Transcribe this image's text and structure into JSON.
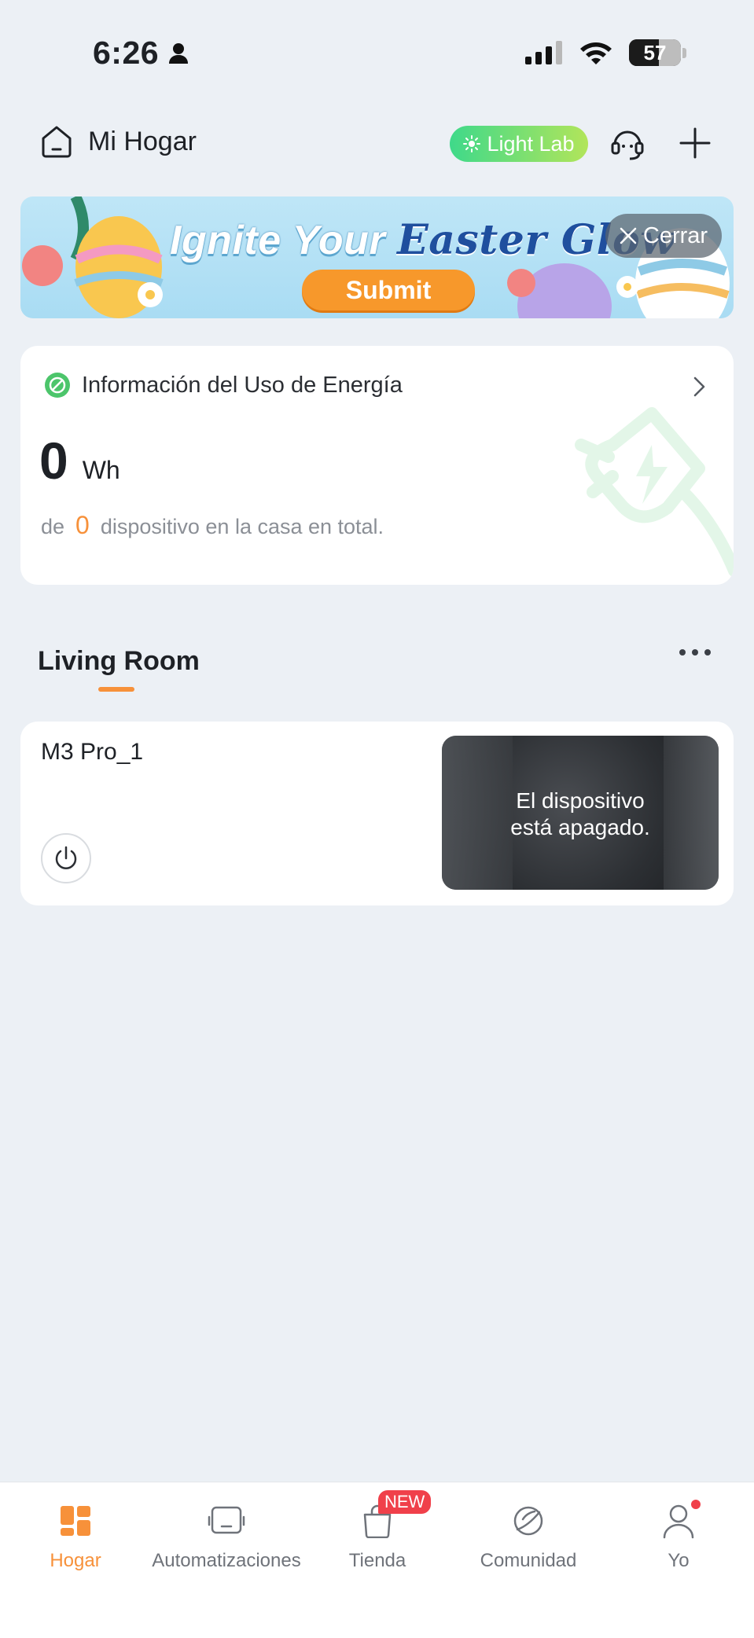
{
  "status_bar": {
    "time": "6:26",
    "battery": "57"
  },
  "header": {
    "home_title": "Mi Hogar",
    "light_lab": "Light Lab"
  },
  "banner": {
    "title_part1": "Ignite Your ",
    "title_part2": "Easter Glow",
    "submit": "Submit",
    "close": "Cerrar"
  },
  "energy": {
    "title": "Información del Uso de Energía",
    "value": "0",
    "unit": "Wh",
    "prefix": "de",
    "count": "0",
    "suffix": "dispositivo en la casa en total."
  },
  "room": {
    "title": "Living Room"
  },
  "device": {
    "name": "M3 Pro_1",
    "status_line1": "El dispositivo",
    "status_line2": "está apagado."
  },
  "bottom_nav": {
    "items": [
      {
        "label": "Hogar",
        "icon": "home-grid-icon",
        "active": true
      },
      {
        "label": "Automatizaciones",
        "icon": "automation-icon",
        "active": false
      },
      {
        "label": "Tienda",
        "icon": "shopping-bag-icon",
        "active": false,
        "badge": "NEW"
      },
      {
        "label": "Comunidad",
        "icon": "community-icon",
        "active": false
      },
      {
        "label": "Yo",
        "icon": "person-icon",
        "active": false
      }
    ]
  },
  "colors": {
    "accent": "#f7913a",
    "background": "#ecf0f5",
    "badge_red": "#f0404a",
    "light_lab_start": "#3fd98a",
    "light_lab_end": "#b2e55a"
  }
}
